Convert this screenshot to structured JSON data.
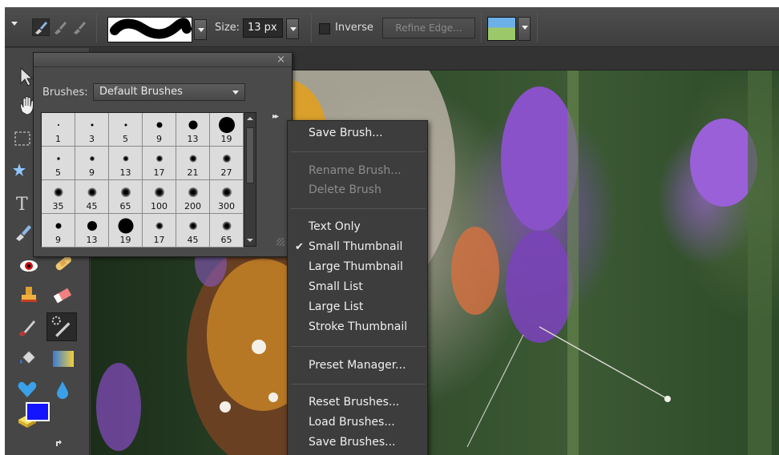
{
  "options_bar": {
    "size_label": "Size:",
    "size_value": "13 px",
    "inverse_label": "Inverse",
    "refine_edge_label": "Refine Edge..."
  },
  "brush_panel": {
    "close_glyph": "×",
    "brushes_label": "Brushes:",
    "brushes_selected": "Default Brushes",
    "flyout_glyph": "▸▸",
    "brushes": [
      {
        "size": "1",
        "dot": 2,
        "soft": false
      },
      {
        "size": "3",
        "dot": 3,
        "soft": false
      },
      {
        "size": "5",
        "dot": 3,
        "soft": false
      },
      {
        "size": "9",
        "dot": 7,
        "soft": false
      },
      {
        "size": "13",
        "dot": 11,
        "soft": false
      },
      {
        "size": "19",
        "dot": 20,
        "soft": false
      },
      {
        "size": "5",
        "dot": 4,
        "soft": true
      },
      {
        "size": "9",
        "dot": 6,
        "soft": true
      },
      {
        "size": "13",
        "dot": 7,
        "soft": true
      },
      {
        "size": "17",
        "dot": 8,
        "soft": true
      },
      {
        "size": "21",
        "dot": 9,
        "soft": true
      },
      {
        "size": "27",
        "dot": 10,
        "soft": true
      },
      {
        "size": "35",
        "dot": 11,
        "soft": true
      },
      {
        "size": "45",
        "dot": 11,
        "soft": true
      },
      {
        "size": "65",
        "dot": 12,
        "soft": true
      },
      {
        "size": "100",
        "dot": 12,
        "soft": true
      },
      {
        "size": "200",
        "dot": 12,
        "soft": true
      },
      {
        "size": "300",
        "dot": 12,
        "soft": true
      },
      {
        "size": "9",
        "dot": 7,
        "soft": false
      },
      {
        "size": "13",
        "dot": 12,
        "soft": false
      },
      {
        "size": "19",
        "dot": 19,
        "soft": false
      },
      {
        "size": "17",
        "dot": 9,
        "soft": true
      },
      {
        "size": "45",
        "dot": 10,
        "soft": true
      },
      {
        "size": "65",
        "dot": 11,
        "soft": true
      }
    ]
  },
  "menu": {
    "save_brush": "Save Brush...",
    "rename_brush": "Rename Brush...",
    "delete_brush": "Delete Brush",
    "text_only": "Text Only",
    "small_thumbnail": "Small Thumbnail",
    "large_thumbnail": "Large Thumbnail",
    "small_list": "Small List",
    "large_list": "Large List",
    "stroke_thumbnail": "Stroke Thumbnail",
    "preset_manager": "Preset Manager...",
    "reset_brushes": "Reset Brushes...",
    "load_brushes": "Load Brushes...",
    "save_brushes": "Save Brushes...",
    "check_glyph": "✔"
  },
  "colors": {
    "foreground": "#1414ff",
    "menu_bg": "#3d3d3d",
    "panel_bg": "#4a4a4a"
  },
  "icons": {
    "brush_tool": "brush-icon",
    "move_tool": "move-icon",
    "hand_tool": "hand-icon",
    "marquee_tool": "marquee-icon",
    "magic_wand_tool": "magic-wand-icon",
    "type_tool": "type-icon",
    "red_eye_tool": "red-eye-icon",
    "healing_tool": "bandage-icon",
    "stamp_tool": "stamp-icon",
    "eraser_tool": "eraser-icon",
    "paint_bucket_tool": "paint-bucket-icon",
    "gradient_tool": "gradient-icon",
    "shape_tool": "heart-shape-icon",
    "blur_tool": "water-drop-icon",
    "sponge_tool": "sponge-icon",
    "swap_colors": "swap-arrow-icon"
  }
}
